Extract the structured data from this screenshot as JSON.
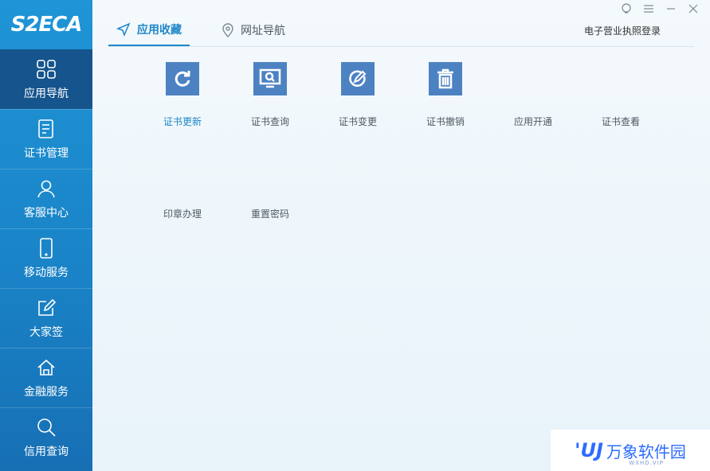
{
  "logo": {
    "text": "S2ECA"
  },
  "sidebar": {
    "items": [
      {
        "label": "应用导航",
        "icon": "grid-icon"
      },
      {
        "label": "证书管理",
        "icon": "document-icon"
      },
      {
        "label": "客服中心",
        "icon": "user-icon"
      },
      {
        "label": "移动服务",
        "icon": "phone-icon"
      },
      {
        "label": "大家签",
        "icon": "edit-icon"
      },
      {
        "label": "金融服务",
        "icon": "home-icon"
      },
      {
        "label": "信用查询",
        "icon": "search-icon"
      }
    ]
  },
  "tabs": [
    {
      "label": "应用收藏",
      "icon": "send-icon"
    },
    {
      "label": "网址导航",
      "icon": "location-pin-icon"
    }
  ],
  "login_link": "电子营业执照登录",
  "apps": [
    {
      "label": "证书更新",
      "icon": "refresh-icon"
    },
    {
      "label": "证书查询",
      "icon": "monitor-search-icon"
    },
    {
      "label": "证书变更",
      "icon": "edit-circle-icon"
    },
    {
      "label": "证书撤销",
      "icon": "trash-icon"
    },
    {
      "label": "应用开通"
    },
    {
      "label": "证书查看"
    },
    {
      "label": "印章办理"
    },
    {
      "label": "重置密码"
    }
  ],
  "watermark": {
    "brand": "万象软件园",
    "sub": "WXHD.VIP"
  },
  "colors": {
    "sidebar": "#1a84c8",
    "active_nav": "#15548c",
    "accent": "#1e86c8",
    "tile": "#4d82c2"
  }
}
